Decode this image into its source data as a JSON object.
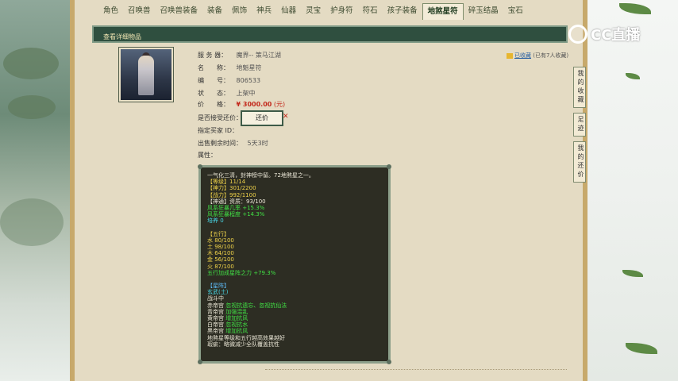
{
  "tabs": [
    "角色",
    "召唤兽",
    "召唤兽装备",
    "装备",
    "佩饰",
    "神兵",
    "仙器",
    "灵宝",
    "护身符",
    "符石",
    "孩子装备",
    "地煞星符",
    "碎玉结晶",
    "宝石"
  ],
  "active_tab_index": 11,
  "section_title": "查看详细物品",
  "info": {
    "server_label": "服 务 器：",
    "server_value": "魔界-- 策马江湖",
    "name_label": "名　　称：",
    "name_value": "地魁星符",
    "id_label": "编　　号：",
    "id_value": "806533",
    "status_label": "状　　态：",
    "status_value": "上架中",
    "price_label": "价　　格：",
    "price_value": "¥ 3000.00",
    "price_unit": "(元)",
    "counter_label": "是否接受还价：",
    "counter_button": "还价",
    "buyer_label": "指定买家 ID：",
    "remaining_label": "出售剩余时间：",
    "remaining_value": "5天3时",
    "attr_label": "属性："
  },
  "favorite": {
    "link": "已收藏",
    "count_text": "(已有7人收藏)"
  },
  "description": {
    "intro": "一气化三清，封神榜中留。72地煞星之一。",
    "level": "【等级】11/14",
    "divinity": "【神力】301/2200",
    "combat": "【战力】992/1100",
    "spirit": "【神通】资质：93/100",
    "wind_freq": "风系狂暴几率 +15.3%",
    "wind_deg": "风系狂暴程度 +14.3%",
    "cultivate": "培养 0",
    "five_title": "【五行】",
    "water": "水 80/100",
    "earth": "土 98/100",
    "wood": "木 64/100",
    "metal": "金 56/100",
    "fire": "火 87/100",
    "five_bonus": "五行加成星阵之力 +79.3%",
    "formation_title": "【星阵】",
    "formation_name": "玄武(土)",
    "battle": "战斗中",
    "red_lord_a": "赤帝宫 ",
    "red_lord_b": "忽视抗遗忘、忽视抗仙法",
    "green_lord_a": "青帝宫 ",
    "green_lord_b": "加强混乱",
    "yellow_lord_a": "黄帝宫 ",
    "yellow_lord_b": "增加抗风",
    "white_lord_a": "白帝宫 ",
    "white_lord_b": "忽视抗水",
    "black_lord_a": "黑帝宫 ",
    "black_lord_b": "增加抗风",
    "note1": "地煞星等级和五行越高效果越好",
    "note2": "瑕疵：略微减少全队覆盖抗性"
  },
  "side_tabs": [
    "我的收藏",
    "足迹",
    "我的还价"
  ],
  "logo_text": "CC直播"
}
